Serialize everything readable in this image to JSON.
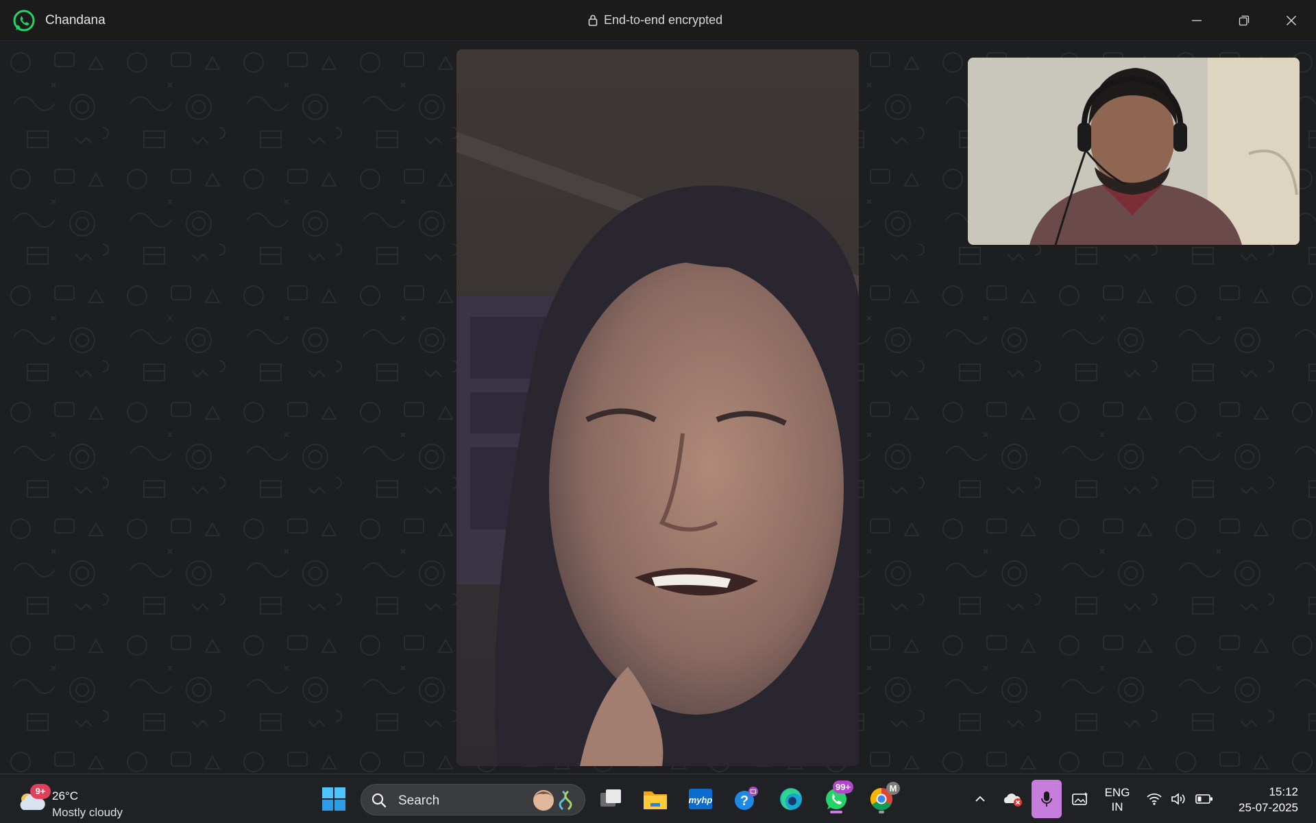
{
  "window": {
    "contact_name": "Chandana",
    "encryption_label": "End-to-end encrypted",
    "controls": {
      "minimize": "minimize-icon",
      "restore": "restore-icon",
      "close": "close-icon"
    }
  },
  "call": {
    "remote_participant": "Chandana",
    "remote_video": "remote-video-feed",
    "self_video": "self-video-preview"
  },
  "taskbar": {
    "weather": {
      "badge": "9+",
      "temperature": "26°C",
      "condition": "Mostly cloudy"
    },
    "search": {
      "placeholder": "Search"
    },
    "pinned": [
      {
        "name": "start-icon"
      },
      {
        "name": "task-view-icon"
      },
      {
        "name": "file-explorer-icon"
      },
      {
        "name": "myhp-icon",
        "label": "myhp"
      },
      {
        "name": "get-help-icon"
      },
      {
        "name": "edge-icon"
      },
      {
        "name": "whatsapp-icon",
        "badge": "99+"
      },
      {
        "name": "chrome-icon",
        "badge": "M"
      }
    ],
    "tray": {
      "language_line1": "ENG",
      "language_line2": "IN",
      "time": "15:12",
      "date": "25-07-2025"
    }
  },
  "colors": {
    "whatsapp_green": "#25d366",
    "badge_pink": "#e0415a",
    "badge_purple": "#b148c9",
    "mic_active": "#c77ddc"
  }
}
